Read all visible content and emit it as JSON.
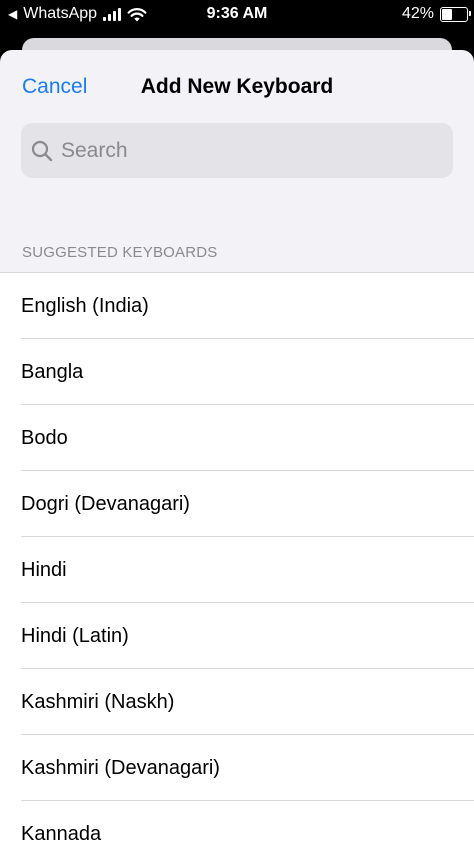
{
  "status_bar": {
    "back_app": "WhatsApp",
    "time": "9:36 AM",
    "battery_percent": "42%",
    "battery_level": 0.42
  },
  "header": {
    "cancel_label": "Cancel",
    "title": "Add New Keyboard"
  },
  "search": {
    "placeholder": "Search",
    "value": ""
  },
  "section": {
    "title": "SUGGESTED KEYBOARDS"
  },
  "keyboards": [
    "English (India)",
    "Bangla",
    "Bodo",
    "Dogri (Devanagari)",
    "Hindi",
    "Hindi (Latin)",
    "Kashmiri (Naskh)",
    "Kashmiri (Devanagari)",
    "Kannada"
  ],
  "colors": {
    "accent": "#1a7cf0",
    "background": "#f2f2f7",
    "separator": "#d7d7db",
    "secondary_text": "#8a8a8e"
  }
}
